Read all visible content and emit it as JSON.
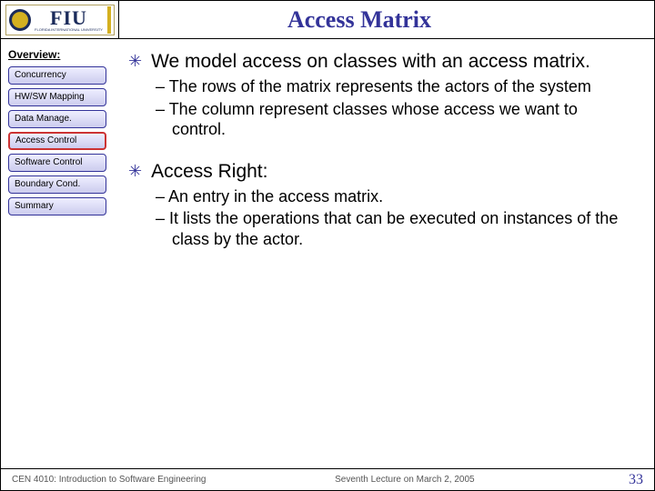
{
  "header": {
    "title": "Access Matrix",
    "logo_main": "FIU",
    "logo_sub": "FLORIDA INTERNATIONAL UNIVERSITY"
  },
  "sidebar": {
    "heading": "Overview:",
    "items": [
      {
        "label": "Concurrency",
        "active": false
      },
      {
        "label": "HW/SW Mapping",
        "active": false
      },
      {
        "label": "Data Manage.",
        "active": false
      },
      {
        "label": "Access Control",
        "active": true
      },
      {
        "label": "Software Control",
        "active": false
      },
      {
        "label": "Boundary Cond.",
        "active": false
      },
      {
        "label": "Summary",
        "active": false
      }
    ]
  },
  "content": {
    "point1": "We model access on classes with an access matrix.",
    "point1_sub1": "The rows of the matrix represents the actors of the system",
    "point1_sub2": "The column represent classes whose access we want to control.",
    "point2": "Access Right:",
    "point2_sub1": "An entry in the access matrix.",
    "point2_sub2": "It lists the operations that can be executed on instances of the class by the actor."
  },
  "footer": {
    "left": "CEN 4010: Introduction to Software Engineering",
    "mid": "Seventh Lecture on March 2, 2005",
    "page": "33"
  }
}
